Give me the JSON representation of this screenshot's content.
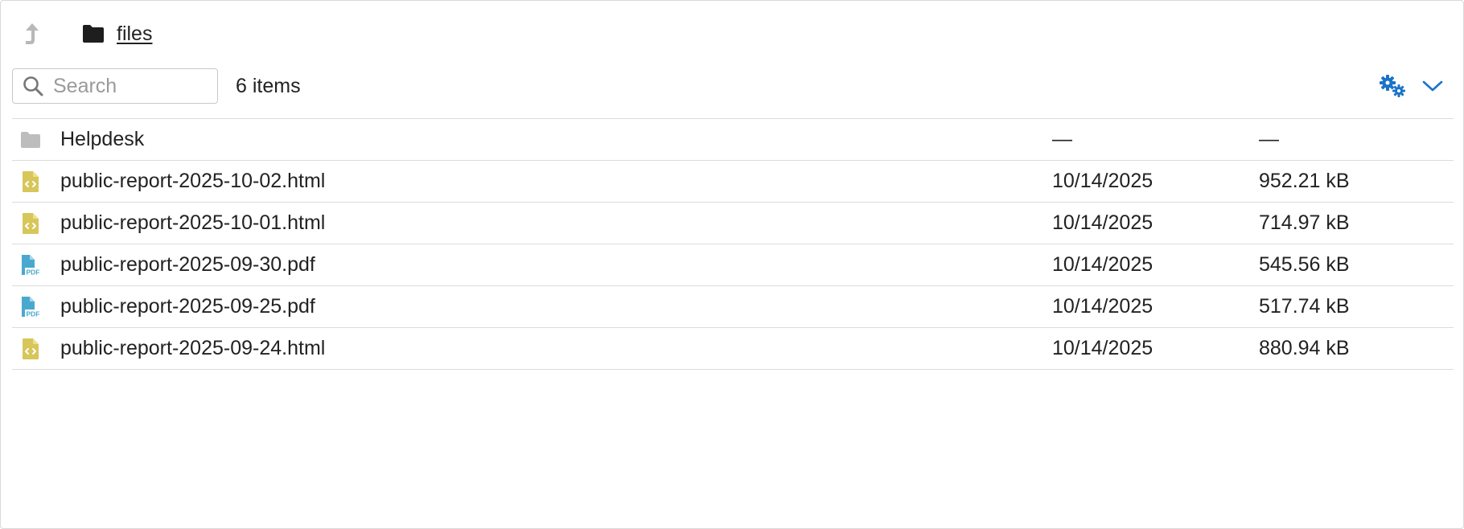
{
  "breadcrumb": {
    "up_icon": "arrow-up-icon",
    "folder_icon": "folder-icon",
    "current": "files"
  },
  "toolbar": {
    "search_placeholder": "Search",
    "search_value": "",
    "item_count": "6 items",
    "settings_icon": "gears-icon",
    "expand_icon": "chevron-down-icon"
  },
  "colors": {
    "accent": "#1a73c8",
    "html_icon": "#d7c65a",
    "pdf_icon": "#4aa8cf",
    "folder_icon": "#bdbdbd"
  },
  "files": [
    {
      "type": "folder",
      "icon": "folder-icon",
      "name": "Helpdesk",
      "date": "—",
      "size": "—"
    },
    {
      "type": "html",
      "icon": "html-file-icon",
      "name": "public-report-2025-10-02.html",
      "date": "10/14/2025",
      "size": "952.21 kB"
    },
    {
      "type": "html",
      "icon": "html-file-icon",
      "name": "public-report-2025-10-01.html",
      "date": "10/14/2025",
      "size": "714.97 kB"
    },
    {
      "type": "pdf",
      "icon": "pdf-file-icon",
      "name": "public-report-2025-09-30.pdf",
      "date": "10/14/2025",
      "size": "545.56 kB"
    },
    {
      "type": "pdf",
      "icon": "pdf-file-icon",
      "name": "public-report-2025-09-25.pdf",
      "date": "10/14/2025",
      "size": "517.74 kB"
    },
    {
      "type": "html",
      "icon": "html-file-icon",
      "name": "public-report-2025-09-24.html",
      "date": "10/14/2025",
      "size": "880.94 kB"
    }
  ]
}
